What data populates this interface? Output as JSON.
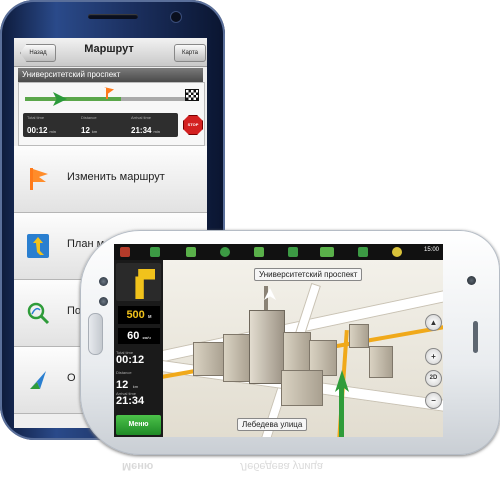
{
  "route_screen": {
    "back_label": "Назад",
    "title": "Маршрут",
    "map_label": "Карта",
    "street": "Университетский проспект",
    "stats": [
      {
        "label": "Total time",
        "value": "00:12",
        "unit": "min"
      },
      {
        "label": "Distance",
        "value": "12",
        "unit": "km"
      },
      {
        "label": "Arrival time",
        "value": "21:34",
        "unit": "min"
      }
    ],
    "stop_label": "STOP",
    "menu": [
      {
        "icon": "flag-icon",
        "label": "Изменить маршрут"
      },
      {
        "icon": "route-plan-icon",
        "label": "План маршрута"
      },
      {
        "icon": "search-route-icon",
        "label": "По"
      },
      {
        "icon": "arrow-cursor-icon",
        "label": "О"
      }
    ]
  },
  "nav_screen": {
    "time": "15:00",
    "street_top": "Университетский проспект",
    "street_bottom": "Лебедева улица",
    "turn_distance": "500",
    "turn_unit": "м",
    "speed": "60",
    "speed_unit": "км/ч",
    "info": [
      {
        "label": "Total time",
        "value": "00:12",
        "unit": ""
      },
      {
        "label": "Distance",
        "value": "12",
        "unit": "km"
      },
      {
        "label": "Arrival time",
        "value": "21:34",
        "unit": ""
      }
    ],
    "menu_label": "Меню",
    "zoom_in": "+",
    "zoom_out": "−",
    "view_mode": "2D",
    "reflection_menu": "Меню",
    "reflection_street": "Лебедева улица"
  },
  "colors": {
    "accent_green": "#2f9c3a",
    "accent_orange": "#ff7a1a",
    "turn_yellow": "#f1c21b",
    "stop_red": "#d32020"
  }
}
